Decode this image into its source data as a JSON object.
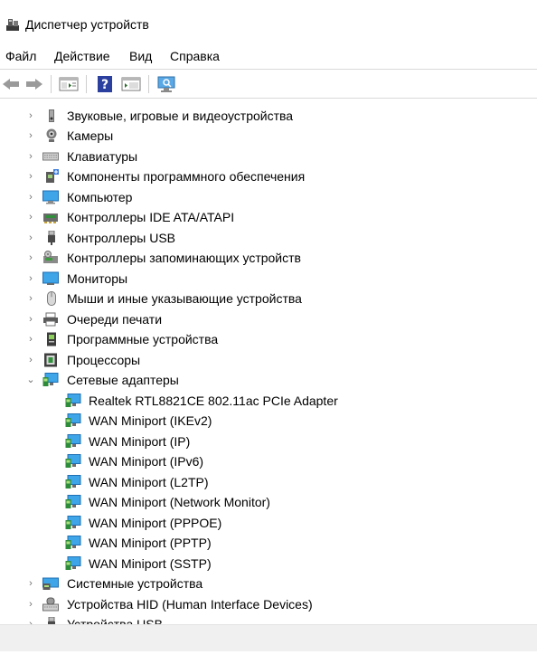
{
  "window": {
    "title": "Диспетчер устройств"
  },
  "menu": {
    "file": "Файл",
    "action": "Действие",
    "view": "Вид",
    "help": "Справка"
  },
  "tree": {
    "categories": [
      {
        "label": "Звуковые, игровые и видеоустройства",
        "icon": "speaker-icon",
        "expanded": false
      },
      {
        "label": "Камеры",
        "icon": "webcam-icon",
        "expanded": false
      },
      {
        "label": "Клавиатуры",
        "icon": "keyboard-icon",
        "expanded": false
      },
      {
        "label": "Компоненты программного обеспечения",
        "icon": "software-component-icon",
        "expanded": false
      },
      {
        "label": "Компьютер",
        "icon": "computer-icon",
        "expanded": false
      },
      {
        "label": "Контроллеры IDE ATA/ATAPI",
        "icon": "ide-controller-icon",
        "expanded": false
      },
      {
        "label": "Контроллеры USB",
        "icon": "usb-icon",
        "expanded": false
      },
      {
        "label": "Контроллеры запоминающих устройств",
        "icon": "storage-controller-icon",
        "expanded": false
      },
      {
        "label": "Мониторы",
        "icon": "monitor-icon",
        "expanded": false
      },
      {
        "label": "Мыши и иные указывающие устройства",
        "icon": "mouse-icon",
        "expanded": false
      },
      {
        "label": "Очереди печати",
        "icon": "printer-icon",
        "expanded": false
      },
      {
        "label": "Программные устройства",
        "icon": "software-device-icon",
        "expanded": false
      },
      {
        "label": "Процессоры",
        "icon": "processor-icon",
        "expanded": false
      },
      {
        "label": "Сетевые адаптеры",
        "icon": "network-adapter-icon",
        "expanded": true
      }
    ],
    "network_adapters": [
      "Realtek RTL8821CE 802.11ac PCIe Adapter",
      "WAN Miniport (IKEv2)",
      "WAN Miniport (IP)",
      "WAN Miniport (IPv6)",
      "WAN Miniport (L2TP)",
      "WAN Miniport (Network Monitor)",
      "WAN Miniport (PPPOE)",
      "WAN Miniport (PPTP)",
      "WAN Miniport (SSTP)"
    ],
    "after": [
      {
        "label": "Системные устройства",
        "icon": "system-device-icon",
        "expanded": false
      },
      {
        "label": "Устройства HID (Human Interface Devices)",
        "icon": "hid-icon",
        "expanded": false
      },
      {
        "label": "Устройства USB",
        "icon": "usb-device-icon",
        "expanded": false
      }
    ]
  }
}
